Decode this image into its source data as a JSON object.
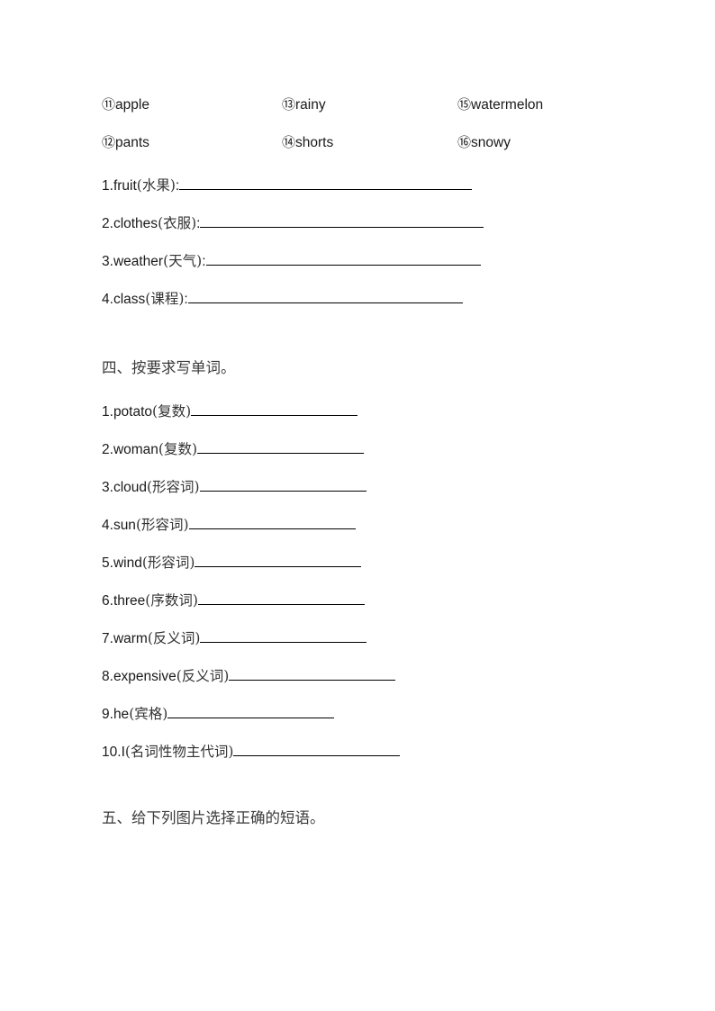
{
  "document": {
    "page_background": "#ffffff",
    "text_color": "#1a1a1a",
    "heading_color": "#3a3a3a"
  },
  "word_bank": {
    "rows": [
      [
        {
          "number": "⑪",
          "word": "apple"
        },
        {
          "number": "⑬",
          "word": "rainy"
        },
        {
          "number": "⑮",
          "word": "watermelon"
        }
      ],
      [
        {
          "number": "⑫",
          "word": "pants"
        },
        {
          "number": "⑭",
          "word": "shorts"
        },
        {
          "number": "⑯",
          "word": "snowy"
        }
      ]
    ]
  },
  "categorize_questions": [
    {
      "index": "1.",
      "word": " fruit",
      "gloss": "(水果)",
      "colon": ":",
      "blank_width": 325
    },
    {
      "index": "2.",
      "word": " clothes",
      "gloss": "(衣服)",
      "colon": ":",
      "blank_width": 315
    },
    {
      "index": "3.",
      "word": " weather",
      "gloss": "(天气)",
      "colon": ":",
      "blank_width": 305
    },
    {
      "index": "4.",
      "word": " class",
      "gloss": "(课程)",
      "colon": ":",
      "blank_width": 305
    }
  ],
  "section_four": {
    "heading": "四、按要求写单词。",
    "questions": [
      {
        "index": "1.",
        "word": " potato",
        "gloss": "(复数)",
        "colon": "",
        "blank_width": 185
      },
      {
        "index": "2.",
        "word": " woman",
        "gloss": "(复数)",
        "colon": "",
        "blank_width": 185
      },
      {
        "index": "3.",
        "word": " cloud",
        "gloss": "(形容词)",
        "colon": "",
        "blank_width": 185
      },
      {
        "index": "4.",
        "word": " sun",
        "gloss": "(形容词)",
        "colon": "",
        "blank_width": 185
      },
      {
        "index": "5.",
        "word": " wind",
        "gloss": "(形容词)",
        "colon": "",
        "blank_width": 185
      },
      {
        "index": "6.",
        "word": " three",
        "gloss": "(序数词)",
        "colon": "",
        "blank_width": 185
      },
      {
        "index": "7.",
        "word": " warm",
        "gloss": "(反义词)",
        "colon": "",
        "blank_width": 185
      },
      {
        "index": "8.",
        "word": " expensive",
        "gloss": "(反义词)",
        "colon": "",
        "blank_width": 185
      },
      {
        "index": "9.",
        "word": " he",
        "gloss": "(宾格)",
        "colon": "",
        "blank_width": 185
      },
      {
        "index": "10.",
        "word": "I",
        "gloss": "(名词性物主代词)",
        "colon": "",
        "blank_width": 185
      }
    ]
  },
  "section_five": {
    "heading": "五、给下列图片选择正确的短语。"
  }
}
